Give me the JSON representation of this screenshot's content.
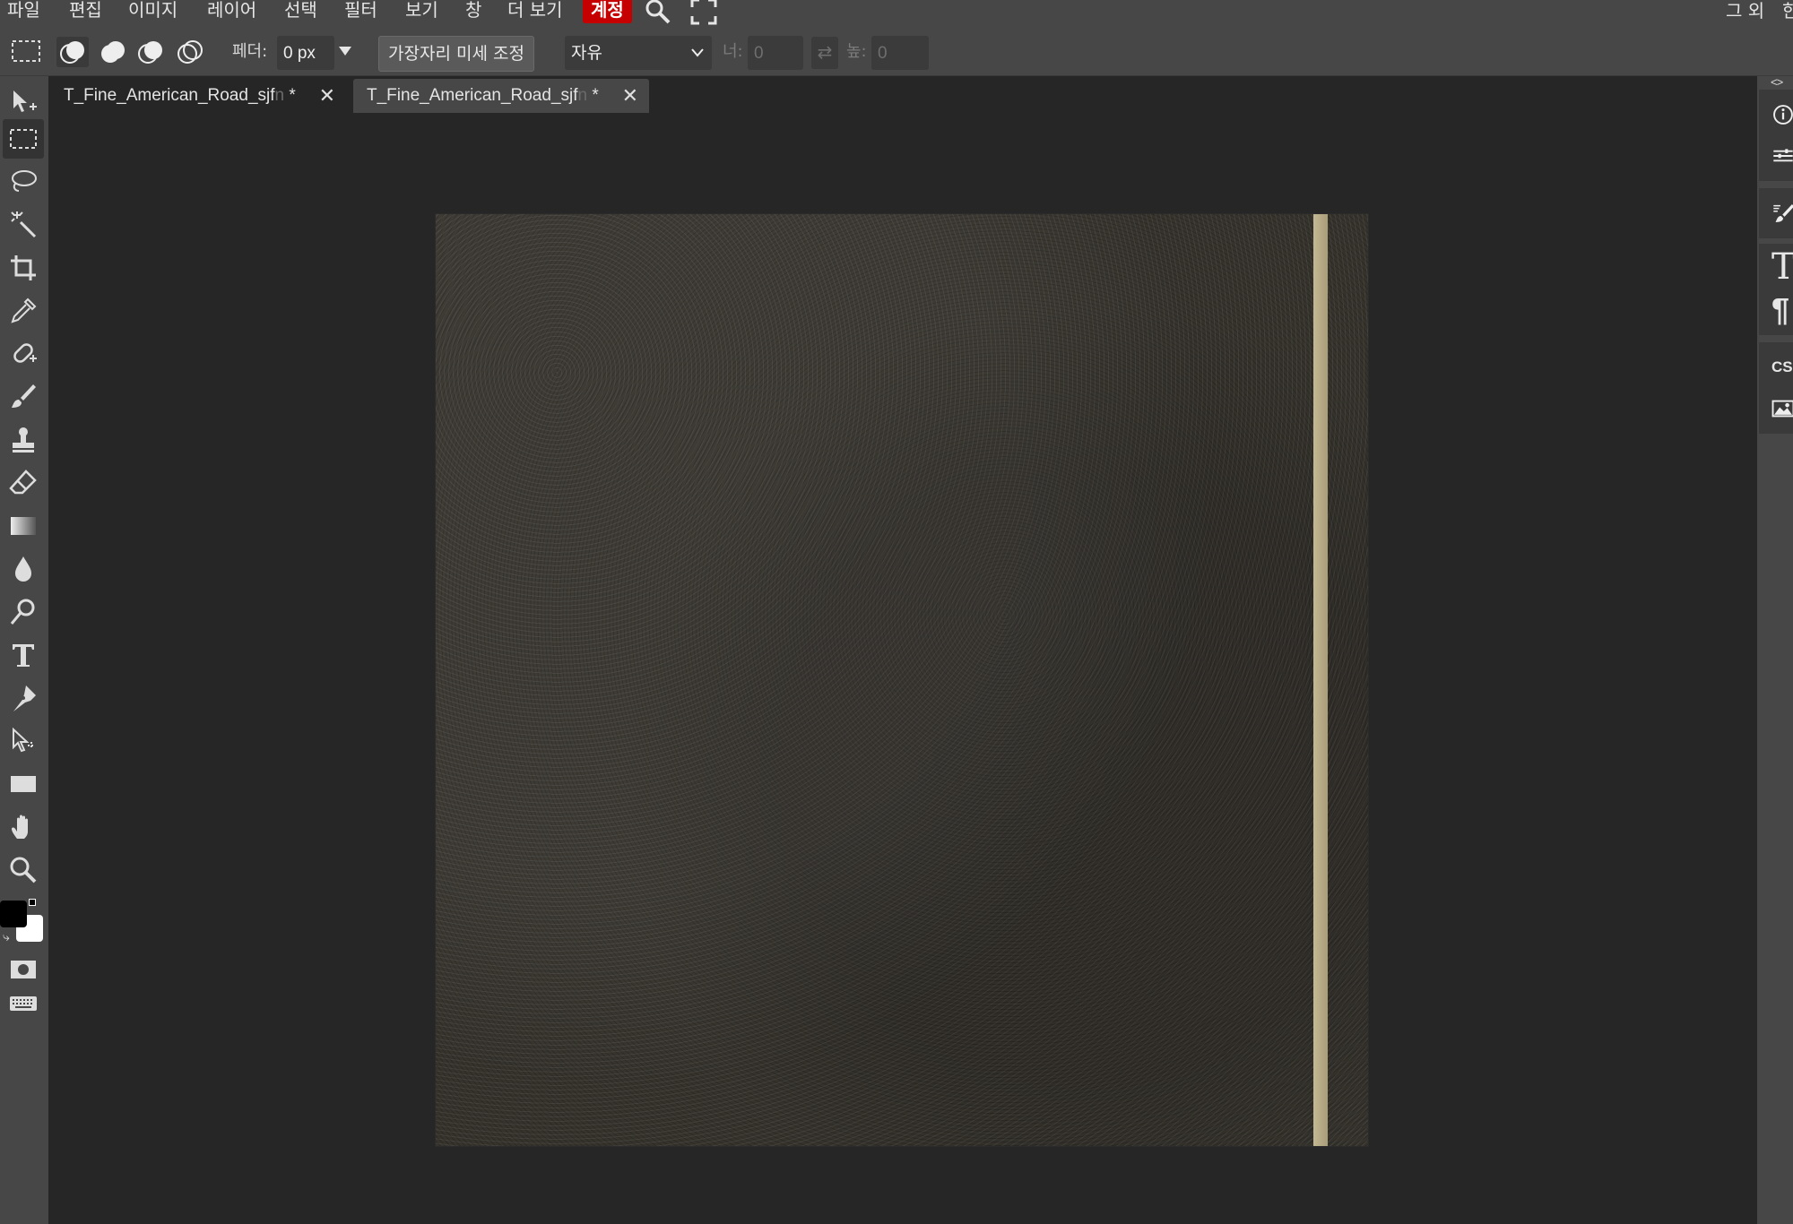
{
  "menu": {
    "items": [
      "파일",
      "편집",
      "이미지",
      "레이어",
      "선택",
      "필터",
      "보기",
      "창",
      "더 보기"
    ],
    "account": "계정",
    "right_items": [
      "그 외",
      "한"
    ]
  },
  "options": {
    "feather_label": "페더:",
    "feather_value": "0 px",
    "refine_edge": "가장자리 미세 조정",
    "style_value": "자유",
    "width_label": "너:",
    "width_value": "0",
    "height_label": "높:",
    "height_value": "0"
  },
  "tabs": [
    {
      "title": "T_Fine_American_Road_sjf",
      "fade": "n",
      "modified": " *"
    },
    {
      "title": "T_Fine_American_Road_sjf",
      "fade": "n",
      "modified": " *"
    }
  ],
  "right_panel": {
    "collapse": "<>",
    "css_label": "CSS",
    "type_label": "Tt"
  },
  "colors": {
    "foreground": "#000000",
    "background": "#ffffff",
    "account_accent": "#c60000"
  },
  "icons": {
    "tools": [
      "move-icon",
      "marquee-icon",
      "lasso-icon",
      "magic-wand-icon",
      "crop-icon",
      "eyedropper-icon",
      "healing-brush-icon",
      "brush-icon",
      "stamp-icon",
      "eraser-icon",
      "gradient-icon",
      "blur-icon",
      "dodge-icon",
      "type-icon",
      "pen-icon",
      "path-select-icon",
      "rectangle-shape-icon",
      "hand-icon",
      "zoom-icon"
    ]
  }
}
